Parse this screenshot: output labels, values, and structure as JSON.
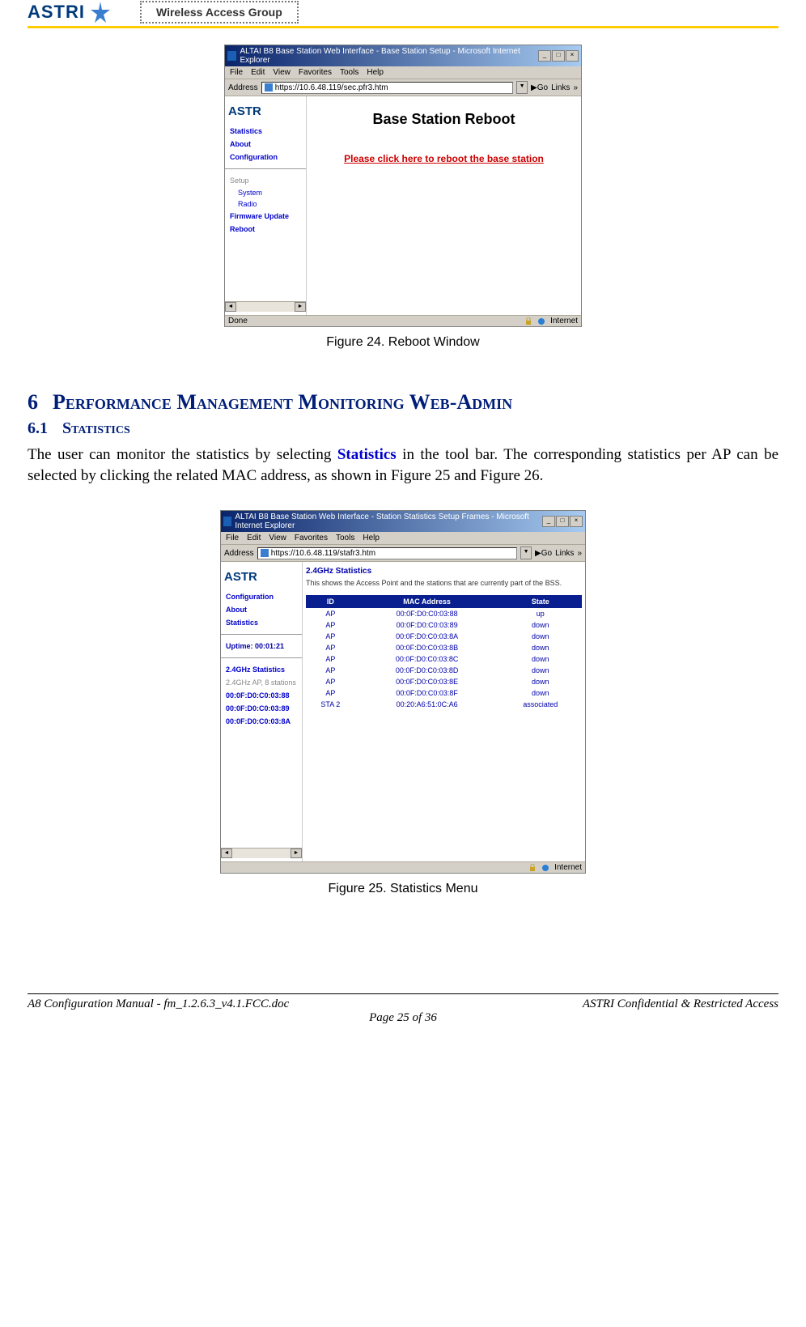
{
  "header": {
    "logo_text": "ASTRI",
    "group_label": "Wireless Access Group"
  },
  "figure24": {
    "window_title": "ALTAI B8 Base Station Web Interface - Base Station Setup - Microsoft Internet Explorer",
    "menu": [
      "File",
      "Edit",
      "View",
      "Favorites",
      "Tools",
      "Help"
    ],
    "address_label": "Address",
    "address_value": "https://10.6.48.119/sec.pfr3.htm",
    "go_label": "Go",
    "links_label": "Links",
    "sidebar_logo": "ASTR",
    "sidebar": {
      "statistics": "Statistics",
      "about": "About",
      "configuration": "Configuration",
      "setup": "Setup",
      "system": "System",
      "radio": "Radio",
      "firmware": "Firmware Update",
      "reboot": "Reboot"
    },
    "main_title": "Base Station Reboot",
    "reboot_link": "Please click here to reboot the base station",
    "status_done": "Done",
    "status_zone": "Internet",
    "caption": "Figure 24. Reboot Window"
  },
  "section6": {
    "num": "6",
    "title": "Performance Management Monitoring Web-Admin"
  },
  "section6_1": {
    "num": "6.1",
    "title": "Statistics"
  },
  "paragraph": {
    "part1": "The user can monitor the statistics by selecting ",
    "keyword": "Statistics",
    "part2": " in the tool bar. The corresponding statistics per AP can be selected by clicking the related MAC address, as shown in Figure 25 and Figure 26."
  },
  "figure25": {
    "window_title": "ALTAI B8 Base Station Web Interface - Station Statistics Setup Frames - Microsoft Internet Explorer",
    "menu": [
      "File",
      "Edit",
      "View",
      "Favorites",
      "Tools",
      "Help"
    ],
    "address_label": "Address",
    "address_value": "https://10.6.48.119/stafr3.htm",
    "go_label": "Go",
    "links_label": "Links",
    "sidebar_logo": "ASTR",
    "sidebar": {
      "configuration": "Configuration",
      "about": "About",
      "statistics": "Statistics",
      "uptime": "Uptime: 00:01:21",
      "ghz_stats": "2.4GHz Statistics",
      "ghz_ap": "2.4GHz AP, 8 stations",
      "mac1": "00:0F:D0:C0:03:88",
      "mac2": "00:0F:D0:C0:03:89",
      "mac3": "00:0F:D0:C0:03:8A"
    },
    "main_section_title": "2.4GHz Statistics",
    "main_section_desc": "This shows the Access Point and the stations that are currently part of the BSS.",
    "table": {
      "headers": [
        "ID",
        "MAC Address",
        "State"
      ],
      "rows": [
        [
          "AP",
          "00:0F:D0:C0:03:88",
          "up"
        ],
        [
          "AP",
          "00:0F:D0:C0:03:89",
          "down"
        ],
        [
          "AP",
          "00:0F:D0:C0:03:8A",
          "down"
        ],
        [
          "AP",
          "00:0F:D0:C0:03:8B",
          "down"
        ],
        [
          "AP",
          "00:0F:D0:C0:03:8C",
          "down"
        ],
        [
          "AP",
          "00:0F:D0:C0:03:8D",
          "down"
        ],
        [
          "AP",
          "00:0F:D0:C0:03:8E",
          "down"
        ],
        [
          "AP",
          "00:0F:D0:C0:03:8F",
          "down"
        ],
        [
          "STA 2",
          "00:20:A6:51:0C:A6",
          "associated"
        ]
      ]
    },
    "status_zone": "Internet",
    "caption": "Figure 25. Statistics Menu"
  },
  "footer": {
    "left": "A8 Configuration Manual - fm_1.2.6.3_v4.1.FCC.doc",
    "right": "ASTRI Confidential & Restricted Access",
    "page": "Page 25 of 36"
  }
}
